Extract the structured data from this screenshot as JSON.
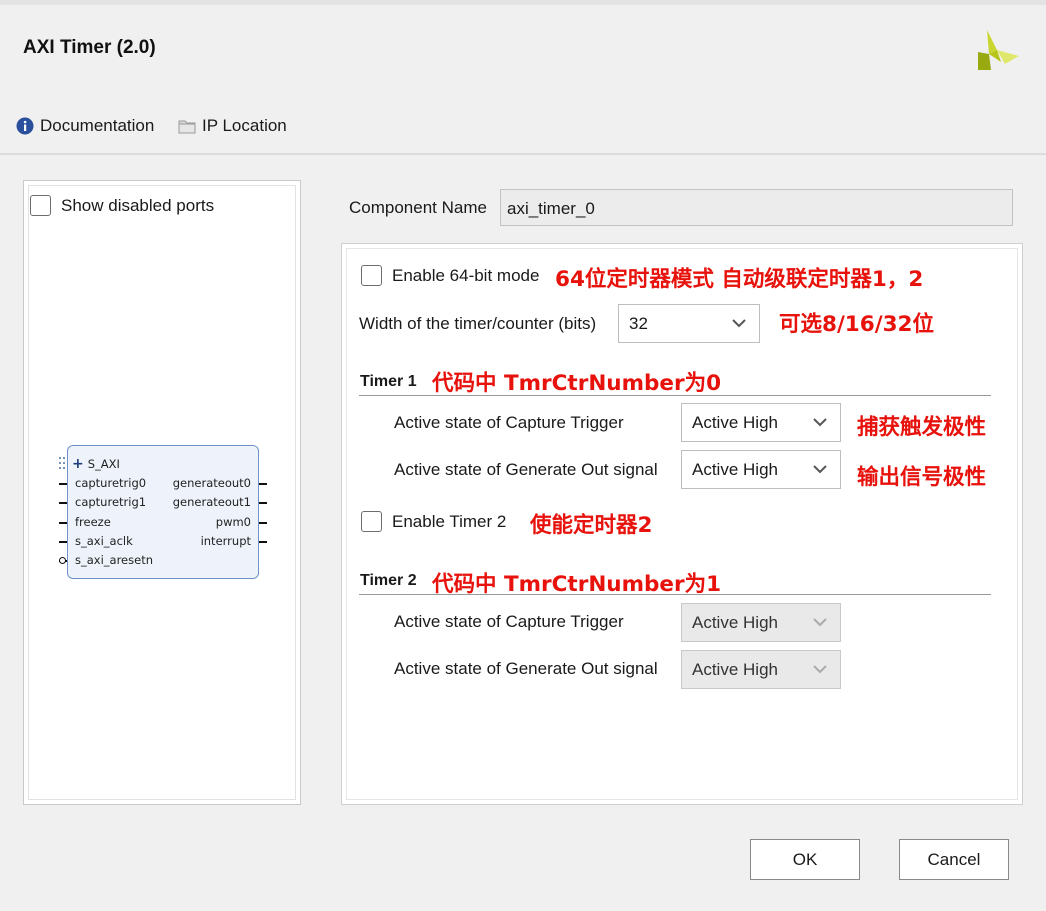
{
  "window": {
    "title": "AXI Timer (2.0)"
  },
  "toolbar": {
    "documentation": "Documentation",
    "ip_location": "IP Location"
  },
  "left_panel": {
    "show_disabled_ports": "Show disabled ports",
    "block": {
      "bus": "S_AXI",
      "inputs": [
        "capturetrig0",
        "capturetrig1",
        "freeze",
        "s_axi_aclk",
        "s_axi_aresetn"
      ],
      "outputs": [
        "generateout0",
        "generateout1",
        "pwm0",
        "interrupt"
      ]
    }
  },
  "component": {
    "label": "Component Name",
    "value": "axi_timer_0"
  },
  "config": {
    "enable_64bit": "Enable 64-bit mode",
    "enable_64bit_note": "64位定时器模式  自动级联定时器1，2",
    "width_label": "Width of the timer/counter (bits)",
    "width_value": "32",
    "width_note": "可选8/16/32位",
    "timer1": {
      "title": "Timer 1",
      "note": "代码中 TmrCtrNumber为0",
      "capture_label": "Active state of Capture Trigger",
      "capture_value": "Active High",
      "capture_note": "捕获触发极性",
      "generate_label": "Active state of Generate Out signal",
      "generate_value": "Active High",
      "generate_note": "输出信号极性"
    },
    "enable_timer2": "Enable Timer 2",
    "enable_timer2_note": "使能定时器2",
    "timer2": {
      "title": "Timer 2",
      "note": "代码中 TmrCtrNumber为1",
      "capture_label": "Active state of Capture Trigger",
      "capture_value": "Active High",
      "generate_label": "Active state of Generate Out signal",
      "generate_value": "Active High"
    }
  },
  "buttons": {
    "ok": "OK",
    "cancel": "Cancel"
  },
  "colors": {
    "annotation": "#e8120c",
    "logo": "#a6b800",
    "block_border": "#6f93c6"
  }
}
